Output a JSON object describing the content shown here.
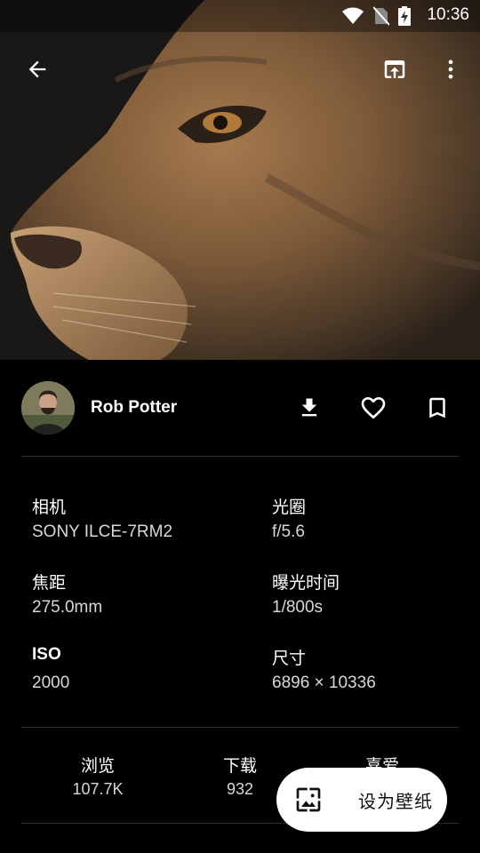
{
  "status_bar": {
    "time": "10:36",
    "icons": [
      "wifi-icon",
      "no-sim-icon",
      "battery-charging-icon"
    ]
  },
  "toolbar": {
    "icons": [
      "back-arrow-icon",
      "open-in-browser-icon",
      "more-vert-icon"
    ]
  },
  "author": {
    "name": "Rob Potter"
  },
  "actions": {
    "icons": [
      "download-icon",
      "heart-outline-icon",
      "bookmark-outline-icon"
    ]
  },
  "exif": [
    {
      "label": "相机",
      "value": "SONY ILCE-7RM2"
    },
    {
      "label": "光圈",
      "value": "f/5.6"
    },
    {
      "label": "焦距",
      "value": "275.0mm"
    },
    {
      "label": "曝光时间",
      "value": "1/800s"
    },
    {
      "label": "ISO",
      "value": "2000"
    },
    {
      "label": "尺寸",
      "value": "6896 × 10336"
    }
  ],
  "stats": [
    {
      "label": "浏览",
      "value": "107.7K"
    },
    {
      "label": "下载",
      "value": "932"
    },
    {
      "label": "喜爱",
      "value": ""
    }
  ],
  "fab": {
    "label": "设为壁纸",
    "icon": "wallpaper-icon"
  }
}
